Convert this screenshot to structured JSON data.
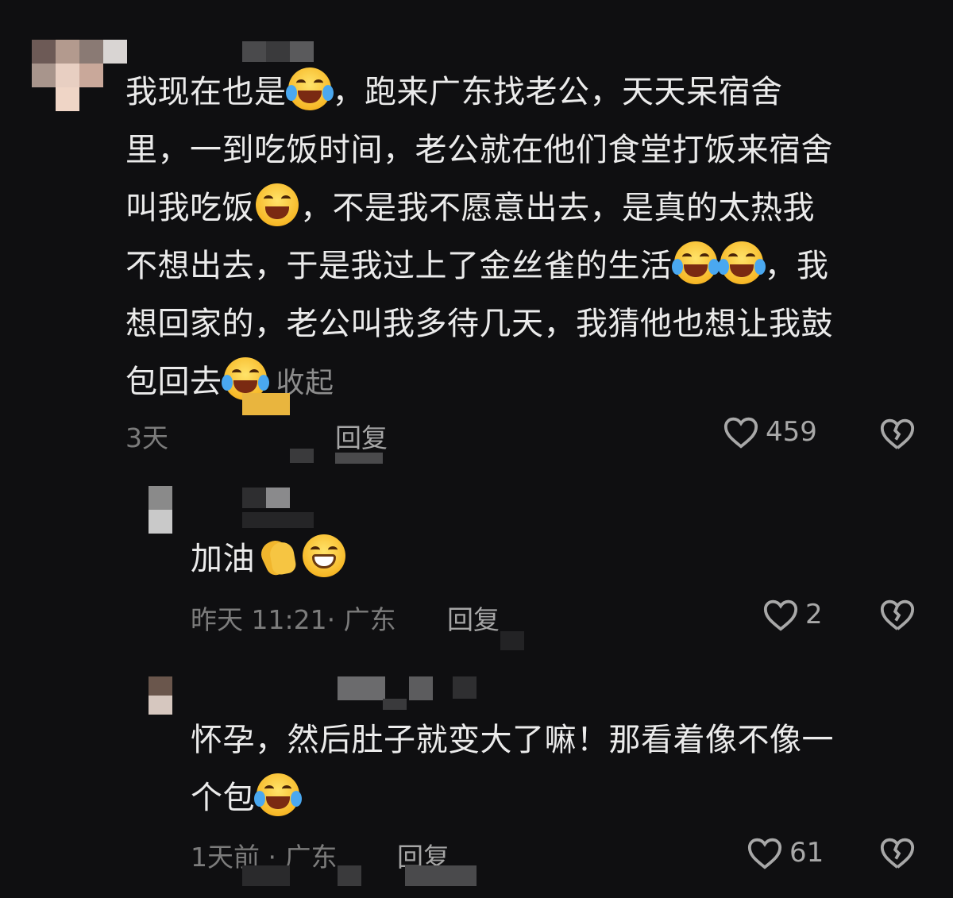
{
  "comments": [
    {
      "text_segments": [
        "我现在也是",
        "，跑来广东找老公，天天呆宿舍里，一到吃饭时间，老公就在他们食堂打饭来宿舍叫我吃饭",
        "，不是我不愿意出去，是真的太热我不想出去，于是我过上了金丝雀的生活",
        "，我想回家的，老公叫我多待几天，我猜他也想让我鼓包回去"
      ],
      "line1a": "我现在也是",
      "line1b": "，跑来广东找老公，天天呆宿舍",
      "line2": "里，一到吃饭时间，老公就在他们食堂打饭来宿舍",
      "line3a": "叫我吃饭",
      "line3b": "，不是我不愿意出去，是真的太热我",
      "line4a": "不想出去，于是我过上了金丝雀的生活",
      "line4b": "，我",
      "line5": "想回家的，老公叫我多待几天，我猜他也想让我鼓",
      "line6": "包回去",
      "collapse_label": "收起",
      "meta": "3天",
      "reply_label": "回复",
      "likes": "459"
    },
    {
      "text": "加油",
      "meta": "昨天 11:21· 广东",
      "reply_label": "回复",
      "likes": "2"
    },
    {
      "line1": "怀孕，然后肚子就变大了嘛！那看着像不像一",
      "line2": "个包",
      "meta": "1天前 · 广东",
      "reply_label": "回复",
      "likes": "61"
    }
  ],
  "icons": {
    "like": "heart-outline-icon",
    "dislike": "broken-heart-icon",
    "laugh_cry": "face-with-tears-of-joy-emoji",
    "cry": "loudly-crying-face-emoji",
    "clap": "clapping-hands-emoji",
    "grin": "grinning-face-emoji"
  }
}
